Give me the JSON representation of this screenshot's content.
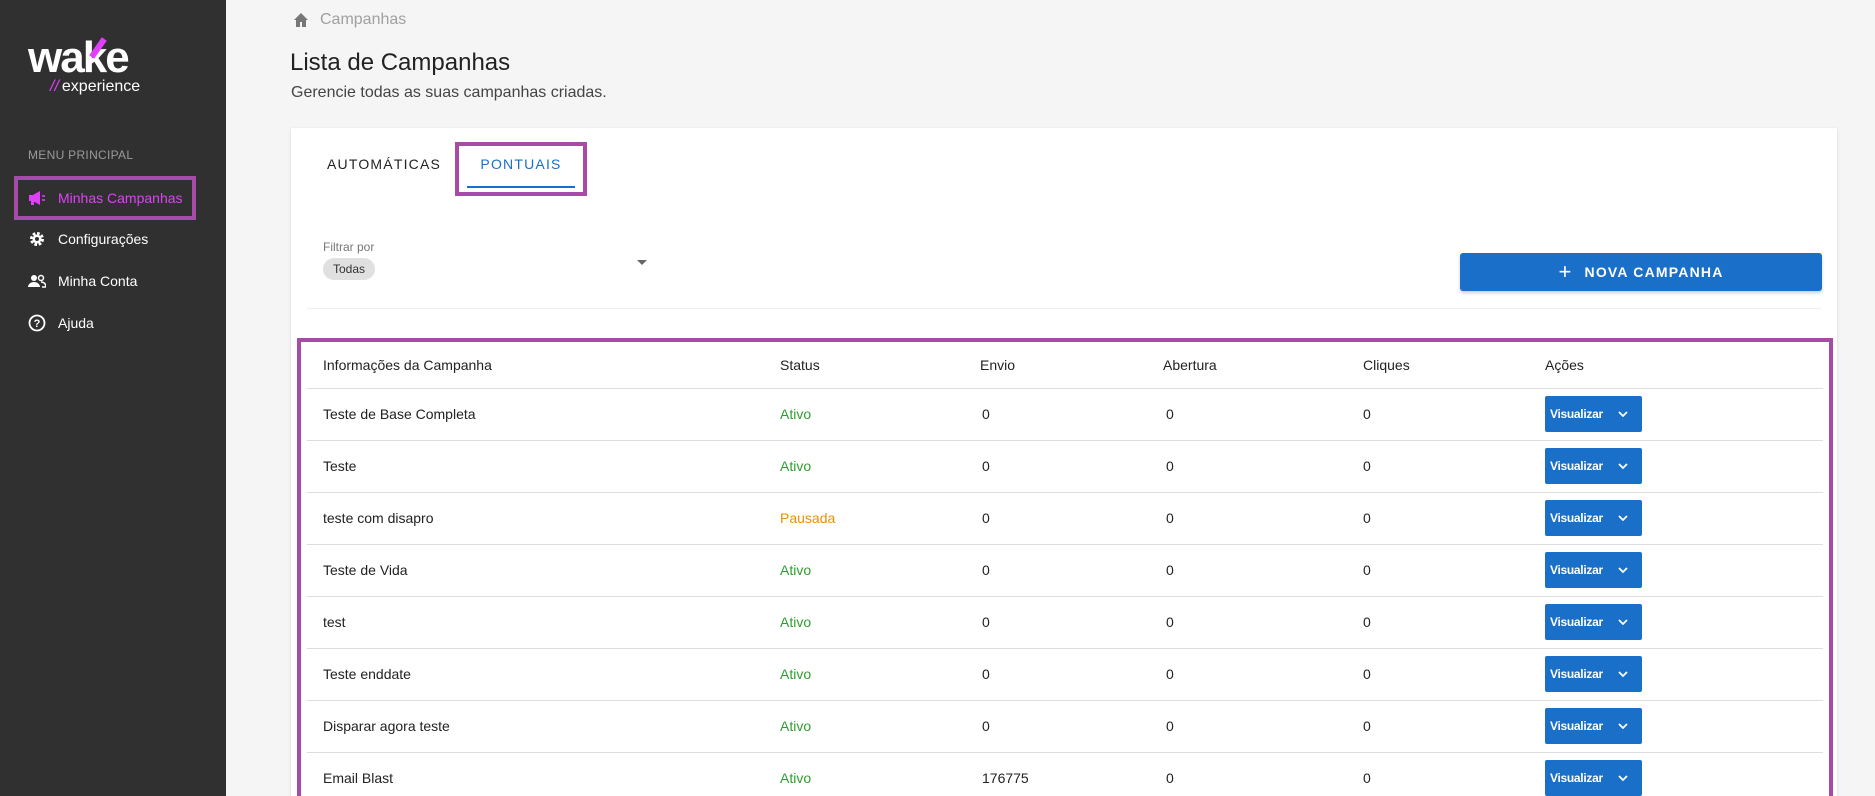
{
  "brand": {
    "logo_word": "wake",
    "logo_sub": "experience",
    "accent": "#e040fb",
    "primary": "#1a6fc9"
  },
  "sidebar": {
    "menu_label": "MENU PRINCIPAL",
    "items": [
      {
        "label": "Minhas Campanhas",
        "icon": "megaphone-icon",
        "active": true
      },
      {
        "label": "Configurações",
        "icon": "gear-icon",
        "active": false
      },
      {
        "label": "Minha Conta",
        "icon": "people-icon",
        "active": false
      },
      {
        "label": "Ajuda",
        "icon": "help-circle-icon",
        "active": false
      }
    ]
  },
  "breadcrumb": {
    "label": "Campanhas",
    "icon": "home-icon"
  },
  "header": {
    "title": "Lista de Campanhas",
    "subtitle": "Gerencie todas as suas campanhas criadas."
  },
  "tabs": [
    {
      "label": "AUTOMÁTICAS",
      "active": false
    },
    {
      "label": "PONTUAIS",
      "active": true
    }
  ],
  "filter": {
    "label": "Filtrar por",
    "value": "Todas"
  },
  "new_button": {
    "label": "NOVA CAMPANHA",
    "icon": "plus-icon"
  },
  "table": {
    "columns": [
      "Informações da Campanha",
      "Status",
      "Envio",
      "Abertura",
      "Cliques",
      "Ações"
    ],
    "action_label": "Visualizar",
    "rows": [
      {
        "name": "Teste de Base Completa",
        "status": "Ativo",
        "envio": "0",
        "abertura": "0",
        "cliques": "0"
      },
      {
        "name": "Teste",
        "status": "Ativo",
        "envio": "0",
        "abertura": "0",
        "cliques": "0"
      },
      {
        "name": "teste com disapro",
        "status": "Pausada",
        "envio": "0",
        "abertura": "0",
        "cliques": "0"
      },
      {
        "name": "Teste de Vida",
        "status": "Ativo",
        "envio": "0",
        "abertura": "0",
        "cliques": "0"
      },
      {
        "name": "test",
        "status": "Ativo",
        "envio": "0",
        "abertura": "0",
        "cliques": "0"
      },
      {
        "name": "Teste enddate",
        "status": "Ativo",
        "envio": "0",
        "abertura": "0",
        "cliques": "0"
      },
      {
        "name": "Disparar agora teste",
        "status": "Ativo",
        "envio": "0",
        "abertura": "0",
        "cliques": "0"
      },
      {
        "name": "Email Blast",
        "status": "Ativo",
        "envio": "176775",
        "abertura": "0",
        "cliques": "0"
      }
    ]
  }
}
